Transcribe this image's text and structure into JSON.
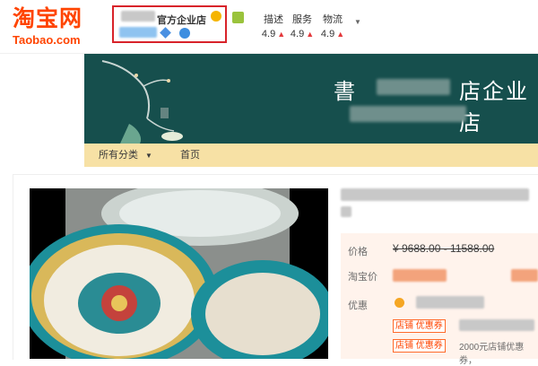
{
  "logo": {
    "cn": "淘宝网",
    "en": "Taobao.com"
  },
  "shop": {
    "name": "官方企业店",
    "badges": [
      "crown-icon",
      "diamond-icon",
      "round-badge-icon"
    ],
    "secondary_badge": "green-badge-icon"
  },
  "ratings": [
    {
      "label": "描述",
      "value": "4.9",
      "trend": "up"
    },
    {
      "label": "服务",
      "value": "4.9",
      "trend": "up"
    },
    {
      "label": "物流",
      "value": "4.9",
      "trend": "up"
    }
  ],
  "ratings_dropdown_icon": "chevron-down-icon",
  "banner": {
    "title_first": "書",
    "title": "店企业店",
    "bg_color": "#164f4d"
  },
  "nav": {
    "categories_label": "所有分类",
    "home_label": "首页",
    "bg_color": "#f7e1a5"
  },
  "product": {
    "info_bg": "#fff3ec",
    "price_label": "价格",
    "price_range": "¥ 9688.00 - 11588.00",
    "taobao_price_label": "淘宝价",
    "discount_label": "优惠",
    "coupons": [
      "店铺 优惠券",
      "店铺 优惠券"
    ],
    "coupon_note": "2000元店铺优惠券，"
  },
  "colors": {
    "brand": "#ff4400",
    "highlight_border": "#d8232a",
    "rating_arrow": "#e4393c"
  }
}
